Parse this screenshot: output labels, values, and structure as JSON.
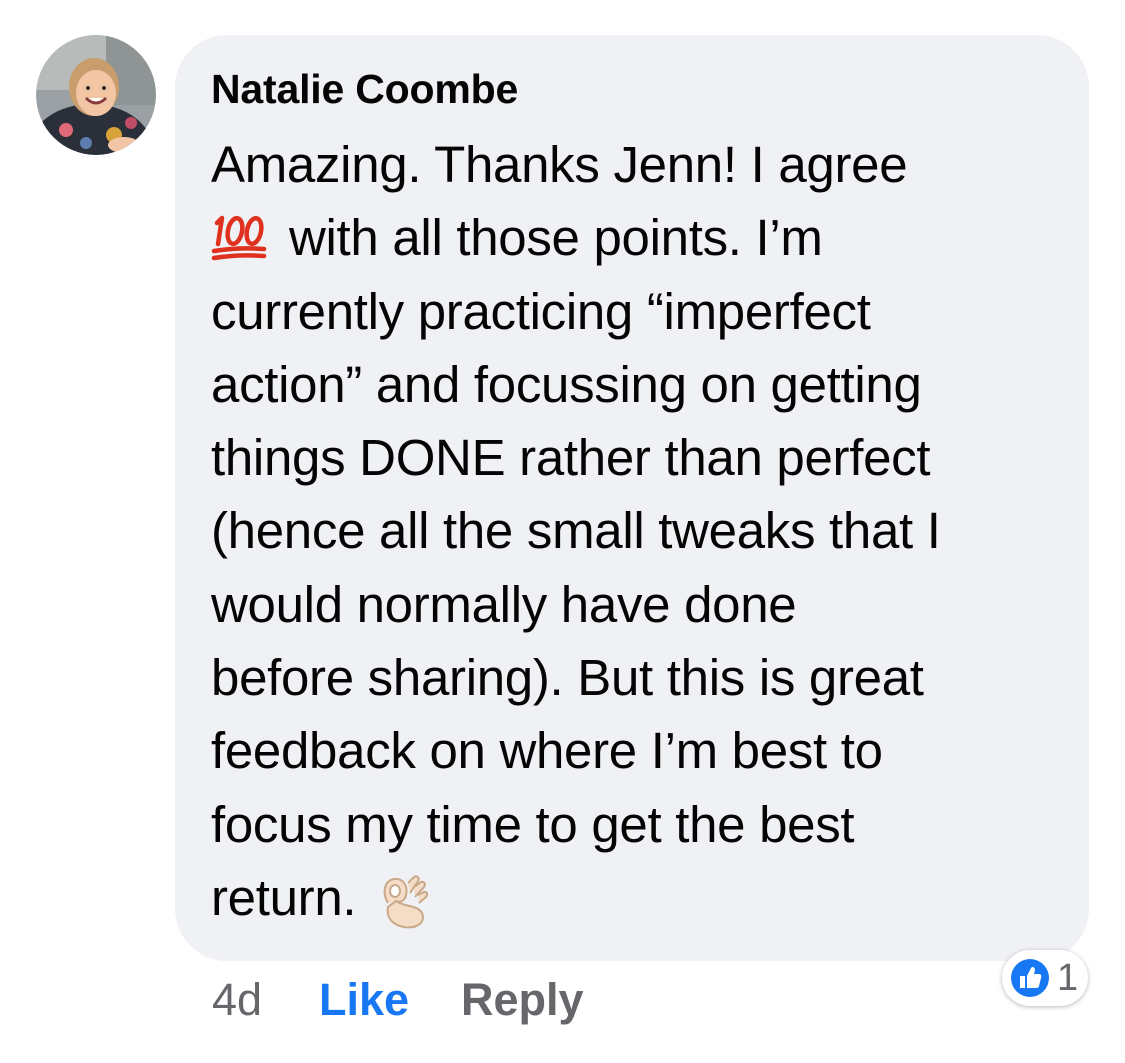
{
  "comment": {
    "author": "Natalie Coombe",
    "lines": [
      "Amazing. Thanks Jenn! I agree",
      "with all those points. I’m",
      "currently  practicing “imperfect",
      "action” and focussing on getting",
      "things DONE rather than perfect",
      "(hence all the small tweaks that I",
      "would normally have done",
      "before sharing). But this is great",
      "feedback on where I’m best to",
      "focus my time to get the best",
      "return."
    ],
    "emojis": [
      "hundred-points-icon",
      "ok-hand-icon"
    ],
    "timestamp": "4d",
    "like_label": "Like",
    "reply_label": "Reply",
    "reaction_count": "1",
    "reaction_icon": "thumbs-up-icon"
  },
  "colors": {
    "bubble": "#f0f1f4",
    "text": "#050505",
    "like_blue": "#1877f2",
    "secondary": "#65676b"
  }
}
